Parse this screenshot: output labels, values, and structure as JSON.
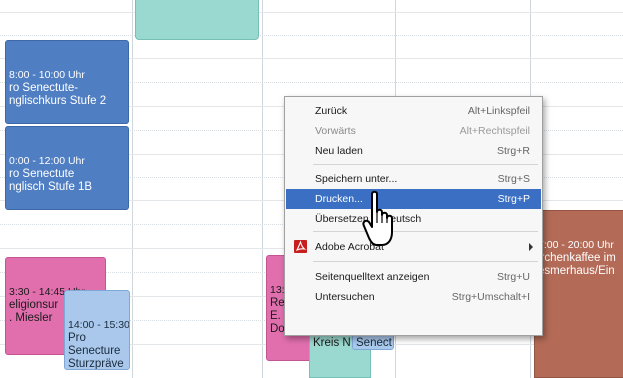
{
  "calendar": {
    "events": [
      {
        "time": "8:00 - 10:00 Uhr",
        "lines": "ro Senectute-\nnglischkurs Stufe 2"
      },
      {
        "time": "0:00 - 12:00 Uhr",
        "lines": "ro Senectute\nnglisch Stufe 1B"
      },
      {
        "time": "3:30 - 14:45 Uhr",
        "lines": "eligionsur\n. Miesler"
      },
      {
        "time": "14:00 - 15:30",
        "lines": "Pro\nSenecture\nSturzpräve"
      },
      {
        "time": "13:",
        "lines": "Re\nE. Paul\nDo"
      },
      {
        "time": "",
        "lines": "Seniore\nKreis N"
      },
      {
        "time": "",
        "lines": "Pro\nSenect"
      },
      {
        "time": "7:00 - 20:00 Uhr",
        "lines": "irchenkaffee im\nesmerhaus/Ein"
      }
    ]
  },
  "context_menu": {
    "items": [
      {
        "label": "Zurück",
        "shortcut": "Alt+Linkspfeil"
      },
      {
        "label": "Vorwärts",
        "shortcut": "Alt+Rechtspfeil"
      },
      {
        "label": "Neu laden",
        "shortcut": "Strg+R"
      },
      {
        "label": "Speichern unter...",
        "shortcut": "Strg+S"
      },
      {
        "label": "Drucken...",
        "shortcut": "Strg+P"
      },
      {
        "label": "Übersetzen in Deutsch",
        "shortcut": ""
      },
      {
        "label": "Adobe Acrobat",
        "shortcut": ""
      },
      {
        "label": "Seitenquelltext anzeigen",
        "shortcut": "Strg+U"
      },
      {
        "label": "Untersuchen",
        "shortcut": "Strg+Umschalt+I"
      }
    ]
  },
  "icons": {
    "pdf": "adobe-acrobat-icon",
    "submenu": "submenu-arrow-icon",
    "cursor": "mouse-pointer-icon"
  },
  "colors": {
    "selection": "#3a6fc4",
    "event_blue": "#4f7ec3",
    "event_pink": "#e16fae",
    "event_teal": "#9ad9d0",
    "event_brown": "#b36b57"
  }
}
